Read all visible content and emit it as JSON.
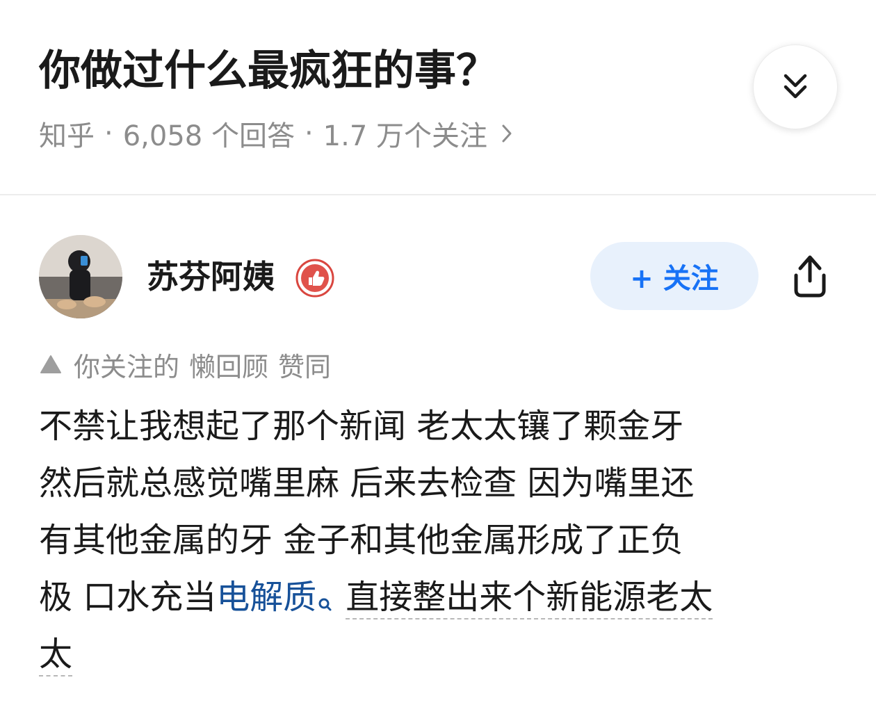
{
  "question": {
    "title": "你做过什么最疯狂的事？",
    "meta": {
      "source": "知乎",
      "separator": "·",
      "answers": "6,058 个回答",
      "followers": "1.7 万个关注"
    },
    "collapse_icon": "double-chevron-down-icon"
  },
  "answer": {
    "author": {
      "name": "苏芬阿姨",
      "badge_icon": "thumbs-up-badge-icon",
      "follow_label": "+ 关注"
    },
    "share_icon": "share-icon",
    "endorsement": {
      "prefix": "你关注的",
      "user": "懒回顾",
      "action": "赞同"
    },
    "body": {
      "line1": "不禁让我想起了那个新闻 老太太镶了颗金牙",
      "line2": "然后就总感觉嘴里麻 后来去检查 因为嘴里还",
      "line3": "有其他金属的牙 金子和其他金属形成了正负",
      "line4_prefix": "极 口水充当",
      "line4_link": "电解质",
      "line4_suffix": "直接整出来个新能源老太",
      "line5": "太"
    }
  },
  "colors": {
    "link": "#175199",
    "follow_text": "#1772f6",
    "follow_bg": "#e8f1fc",
    "meta_gray": "#8c8c8c"
  }
}
